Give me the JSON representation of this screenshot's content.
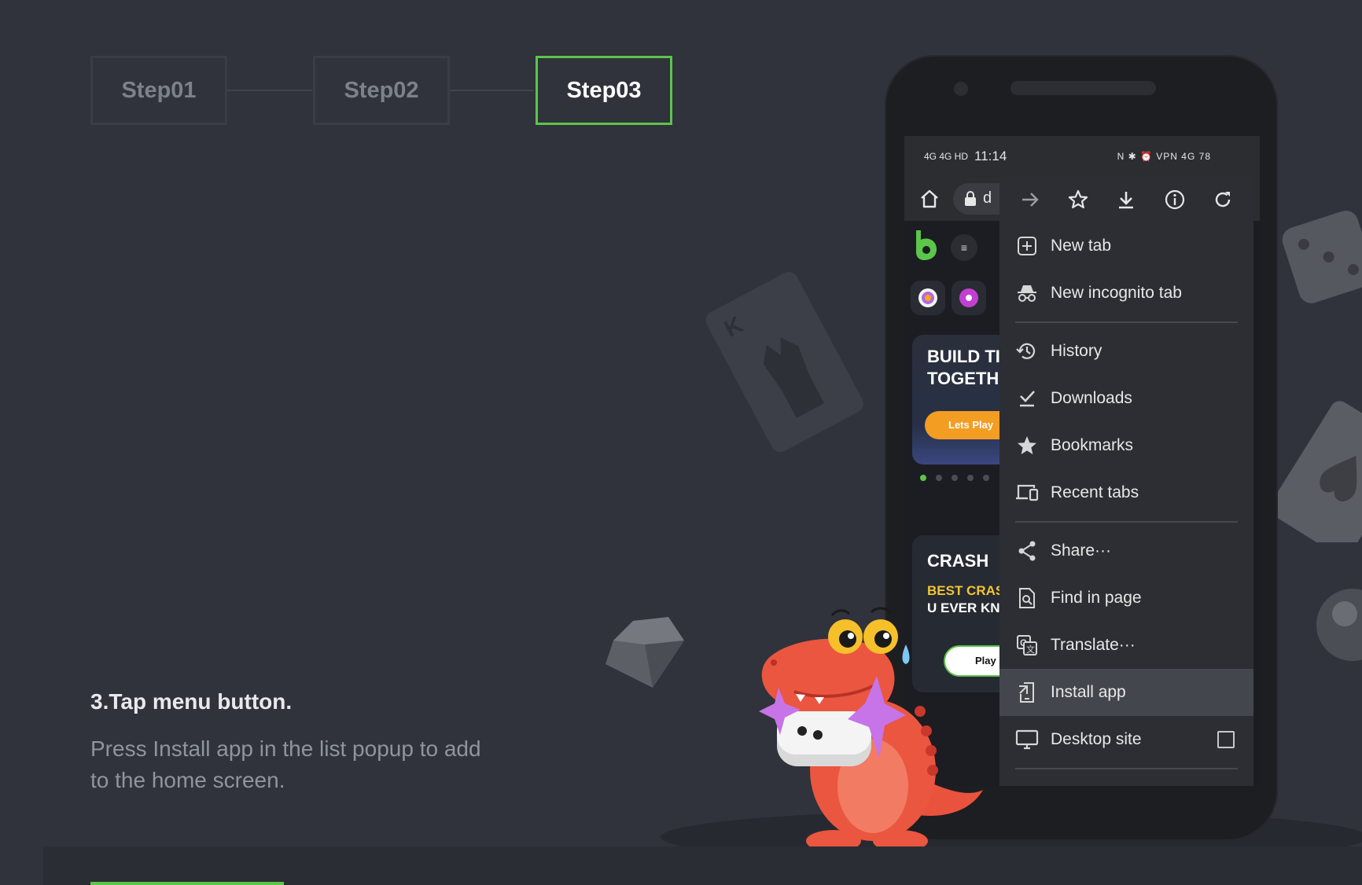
{
  "steps": [
    {
      "label": "Step01",
      "active": false
    },
    {
      "label": "Step02",
      "active": false
    },
    {
      "label": "Step03",
      "active": true
    }
  ],
  "instruction": {
    "title": "3.Tap menu button.",
    "body": "Press Install app in the list popup to add to the home screen."
  },
  "phone": {
    "status_bar": {
      "left_indicators": "4G 4G HD",
      "time": "11:14",
      "right_indicators": "N ✱ ⏰ VPN 4G 78"
    },
    "address_bar": {
      "text": "d"
    },
    "site": {
      "banner": {
        "text": "BUILD TI\nTOGETH",
        "button": "Lets Play"
      },
      "crash_card": {
        "title": "CRASH",
        "subtitle": "BEST CRAS",
        "subtitle2": "U EVER KN",
        "button": "Play Now"
      }
    },
    "menu": {
      "top_icons": [
        "forward-icon",
        "star-outline-icon",
        "download-icon",
        "info-icon",
        "refresh-icon"
      ],
      "groups": [
        [
          {
            "label": "New tab",
            "icon": "plus-box-icon"
          },
          {
            "label": "New incognito tab",
            "icon": "incognito-icon"
          }
        ],
        [
          {
            "label": "History",
            "icon": "history-icon"
          },
          {
            "label": "Downloads",
            "icon": "download-check-icon"
          },
          {
            "label": "Bookmarks",
            "icon": "star-filled-icon"
          },
          {
            "label": "Recent tabs",
            "icon": "devices-icon"
          }
        ],
        [
          {
            "label": "Share···",
            "icon": "share-icon"
          },
          {
            "label": "Find in page",
            "icon": "find-in-page-icon"
          },
          {
            "label": "Translate···",
            "icon": "translate-icon"
          },
          {
            "label": "Install app",
            "icon": "install-app-icon",
            "selected": true
          },
          {
            "label": "Desktop site",
            "icon": "monitor-icon",
            "checkbox": true,
            "checked": false
          }
        ]
      ]
    }
  },
  "colors": {
    "background": "#30333b",
    "accent": "#5cc54a",
    "menu_bg": "#2c2e33",
    "menu_selected": "#43464c"
  }
}
